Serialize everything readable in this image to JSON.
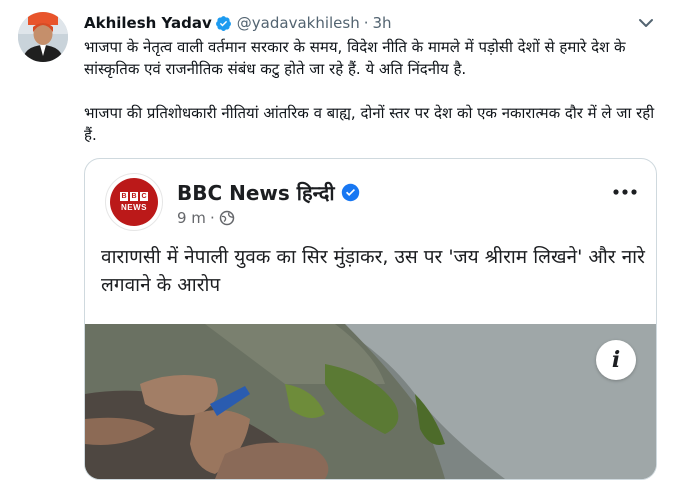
{
  "tweet": {
    "author_name": "Akhilesh Yadav",
    "handle": "@yadavakhilesh",
    "separator": "·",
    "time": "3h",
    "paragraph_1": "भाजपा के नेतृत्व वाली वर्तमान सरकार के समय, विदेश नीति के मामले में पड़ोसी देशों से हमारे देश के सांस्कृतिक एवं राजनीतिक संबंध कटु होते जा रहे हैं. ये अति निंदनीय है.",
    "paragraph_2": "भाजपा की प्रतिशोधकारी नीतियां आंतरिक व बाह्य, दोनों स्तर पर देश को एक नकारात्मक दौर में ले जा रही हैं.",
    "more_icon": "chevron-down-icon"
  },
  "card": {
    "page_name": "BBC News हिन्दी",
    "logo_letters": [
      "B",
      "B",
      "C"
    ],
    "logo_word": "NEWS",
    "time": "9 m",
    "separator": "·",
    "privacy_icon": "globe-icon",
    "more_icon": "ellipsis-icon",
    "headline": "वाराणसी में नेपाली युवक का सिर मुंड़ाकर, उस पर 'जय श्रीराम लिखने' और नारे लगवाने के आरोप",
    "info_label": "i"
  },
  "colors": {
    "verified": "#1d9bf0",
    "bbc_red": "#bb1919",
    "muted": "#536471"
  }
}
